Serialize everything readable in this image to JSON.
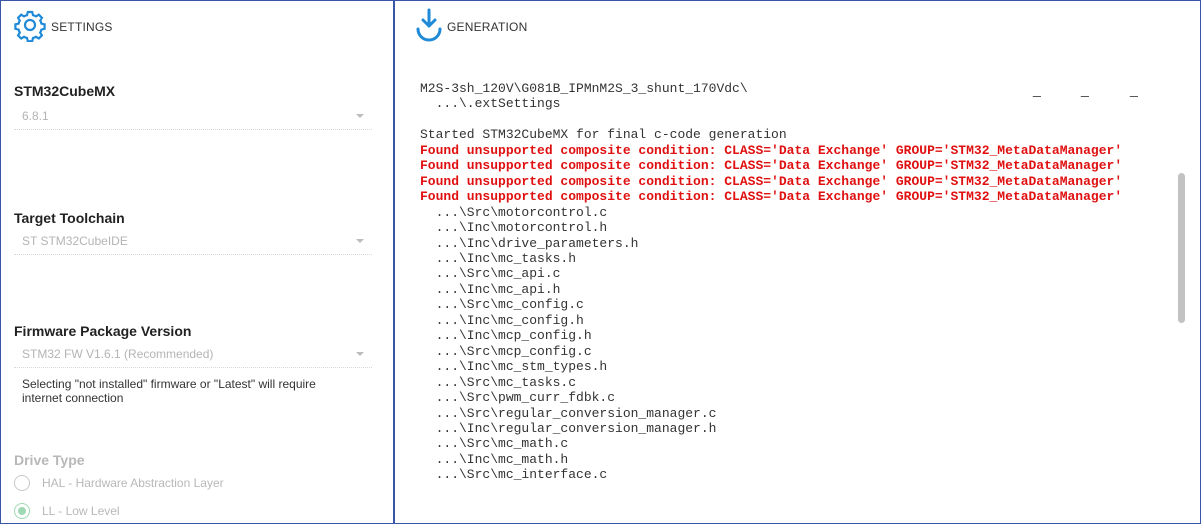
{
  "settings": {
    "header_label": "SETTINGS",
    "stm32cubemx": {
      "title": "STM32CubeMX",
      "value": "6.8.1"
    },
    "toolchain": {
      "title": "Target Toolchain",
      "value": "ST STM32CubeIDE"
    },
    "firmware": {
      "title": "Firmware Package Version",
      "value": "STM32 FW V1.6.1 (Recommended)",
      "note": "Selecting \"not installed\" firmware or \"Latest\" will require internet connection"
    },
    "drive_type": {
      "title": "Drive Type",
      "options": [
        {
          "label": "HAL - Hardware Abstraction Layer",
          "selected": false
        },
        {
          "label": "LL - Low Level",
          "selected": true
        }
      ]
    }
  },
  "generation": {
    "header_label": "GENERATION",
    "window_controls": [
      "_",
      "_",
      "_"
    ],
    "log_lines": [
      {
        "text": "M2S-3sh_120V\\G081B_IPMnM2S_3_shunt_170Vdc\\",
        "error": false
      },
      {
        "text": "  ...\\.extSettings",
        "error": false
      },
      {
        "text": "",
        "error": false
      },
      {
        "text": "Started STM32CubeMX for final c-code generation",
        "error": false
      },
      {
        "text": "Found unsupported composite condition: CLASS='Data Exchange' GROUP='STM32_MetaDataManager'",
        "error": true
      },
      {
        "text": "Found unsupported composite condition: CLASS='Data Exchange' GROUP='STM32_MetaDataManager'",
        "error": true
      },
      {
        "text": "Found unsupported composite condition: CLASS='Data Exchange' GROUP='STM32_MetaDataManager'",
        "error": true
      },
      {
        "text": "Found unsupported composite condition: CLASS='Data Exchange' GROUP='STM32_MetaDataManager'",
        "error": true
      },
      {
        "text": "  ...\\Src\\motorcontrol.c",
        "error": false
      },
      {
        "text": "  ...\\Inc\\motorcontrol.h",
        "error": false
      },
      {
        "text": "  ...\\Inc\\drive_parameters.h",
        "error": false
      },
      {
        "text": "  ...\\Inc\\mc_tasks.h",
        "error": false
      },
      {
        "text": "  ...\\Src\\mc_api.c",
        "error": false
      },
      {
        "text": "  ...\\Inc\\mc_api.h",
        "error": false
      },
      {
        "text": "  ...\\Src\\mc_config.c",
        "error": false
      },
      {
        "text": "  ...\\Inc\\mc_config.h",
        "error": false
      },
      {
        "text": "  ...\\Inc\\mcp_config.h",
        "error": false
      },
      {
        "text": "  ...\\Src\\mcp_config.c",
        "error": false
      },
      {
        "text": "  ...\\Inc\\mc_stm_types.h",
        "error": false
      },
      {
        "text": "  ...\\Src\\mc_tasks.c",
        "error": false
      },
      {
        "text": "  ...\\Src\\pwm_curr_fdbk.c",
        "error": false
      },
      {
        "text": "  ...\\Src\\regular_conversion_manager.c",
        "error": false
      },
      {
        "text": "  ...\\Inc\\regular_conversion_manager.h",
        "error": false
      },
      {
        "text": "  ...\\Src\\mc_math.c",
        "error": false
      },
      {
        "text": "  ...\\Inc\\mc_math.h",
        "error": false
      },
      {
        "text": "  ...\\Src\\mc_interface.c",
        "error": false
      }
    ]
  },
  "colors": {
    "accent_blue": "#1f8ad8",
    "border_blue": "#3a56a8",
    "error_red": "#e01010",
    "radio_green": "#9fd9b4"
  },
  "icons": {
    "settings": "gear-icon",
    "generation": "download-icon"
  }
}
